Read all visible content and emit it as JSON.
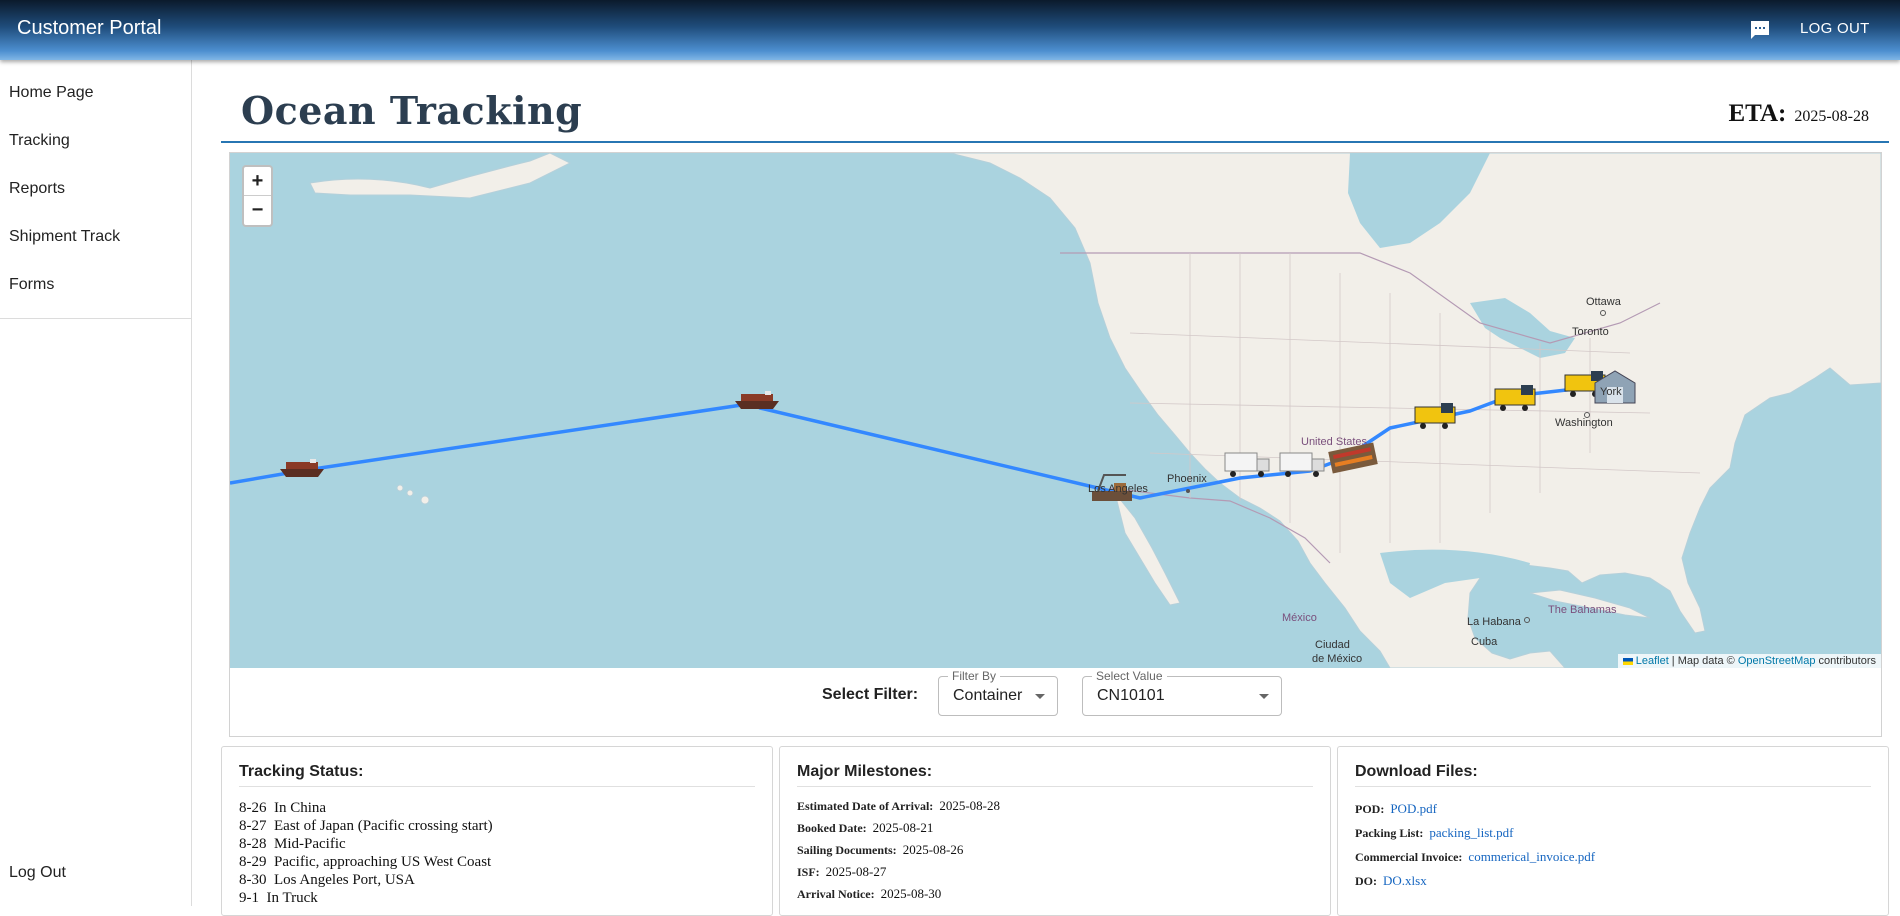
{
  "app": {
    "title": "Customer Portal",
    "logout_label": "LOG OUT",
    "chat_icon": "chat-icon"
  },
  "sidebar": {
    "items": [
      {
        "label": "Home Page"
      },
      {
        "label": "Tracking"
      },
      {
        "label": "Reports"
      },
      {
        "label": "Shipment Track"
      },
      {
        "label": "Forms"
      }
    ],
    "logout_label": "Log Out"
  },
  "header": {
    "title": "Ocean Tracking",
    "eta_label": "ETA:",
    "eta_value": "2025-08-28"
  },
  "map": {
    "zoom_in": "+",
    "zoom_out": "−",
    "attribution": {
      "leaflet": "Leaflet",
      "text": " | Map data © ",
      "osm": "OpenStreetMap",
      "suffix": " contributors"
    },
    "places": {
      "ottawa": "Ottawa",
      "toronto": "Toronto",
      "new_york": "York",
      "washington": "Washington",
      "united_states": "United States",
      "phoenix": "Phoenix",
      "los_angeles": "Los Angeles",
      "mexico": "México",
      "ciudad_de_mexico_1": "Ciudad",
      "ciudad_de_mexico_2": "de México",
      "la_habana": "La Habana",
      "bahamas": "The Bahamas",
      "cuba": "Cuba"
    },
    "route_color": "#3388ff",
    "markers": [
      "ship-icon",
      "ship-icon",
      "port-icon",
      "truck-icon",
      "truck-icon",
      "railyard-icon",
      "train-icon",
      "train-icon",
      "train-icon",
      "warehouse-icon"
    ]
  },
  "filter": {
    "label": "Select Filter:",
    "filter_by": {
      "legend": "Filter By",
      "value": "Container"
    },
    "select_value": {
      "legend": "Select Value",
      "value": "CN10101"
    }
  },
  "tracking_status": {
    "title": "Tracking Status:",
    "lines": [
      "8-26  In China",
      "8-27  East of Japan (Pacific crossing start)",
      "8-28  Mid-Pacific",
      "8-29  Pacific, approaching US West Coast",
      "8-30  Los Angeles Port, USA",
      "9-1  In Truck"
    ]
  },
  "milestones": {
    "title": "Major Milestones:",
    "items": [
      {
        "label": "Estimated Date of Arrival:",
        "value": "2025-08-28"
      },
      {
        "label": "Booked Date:",
        "value": "2025-08-21"
      },
      {
        "label": "Sailing Documents:",
        "value": "2025-08-26"
      },
      {
        "label": "ISF:",
        "value": "2025-08-27"
      },
      {
        "label": "Arrival Notice:",
        "value": "2025-08-30"
      }
    ]
  },
  "downloads": {
    "title": "Download Files:",
    "items": [
      {
        "label": "POD:",
        "file": "POD.pdf"
      },
      {
        "label": "Packing List:",
        "file": "packing_list.pdf"
      },
      {
        "label": "Commercial Invoice:",
        "file": "commerical_invoice.pdf"
      },
      {
        "label": "DO:",
        "file": "DO.xlsx"
      }
    ]
  }
}
